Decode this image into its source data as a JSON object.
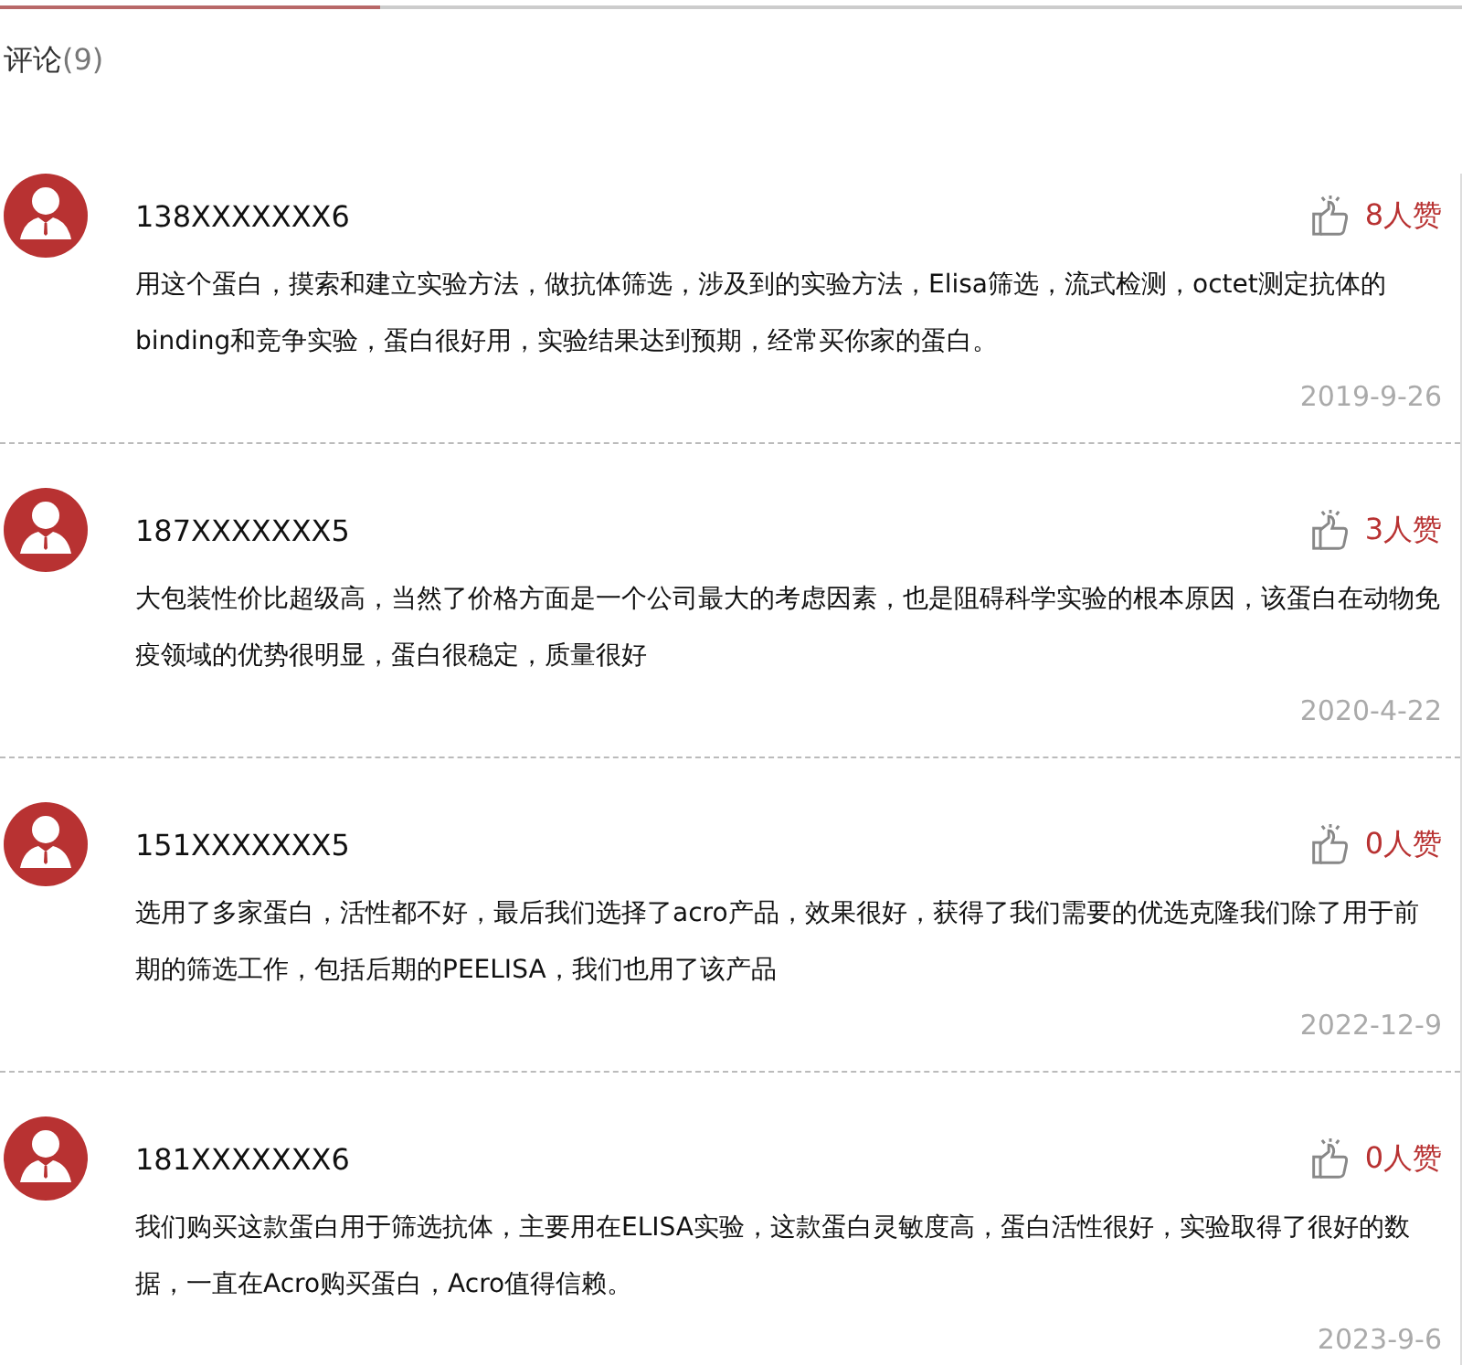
{
  "heading": {
    "label": "评论",
    "count": "(9)"
  },
  "comments": [
    {
      "user": "138XXXXXXX6",
      "likes": "8人赞",
      "text": "用这个蛋白，摸索和建立实验方法，做抗体筛选，涉及到的实验方法，Elisa筛选，流式检测，octet测定抗体的binding和竞争实验，蛋白很好用，实验结果达到预期，经常买你家的蛋白。",
      "date": "2019-9-26"
    },
    {
      "user": "187XXXXXXX5",
      "likes": "3人赞",
      "text": "大包装性价比超级高，当然了价格方面是一个公司最大的考虑因素，也是阻碍科学实验的根本原因，该蛋白在动物免疫领域的优势很明显，蛋白很稳定，质量很好",
      "date": "2020-4-22"
    },
    {
      "user": "151XXXXXXX5",
      "likes": "0人赞",
      "text": "选用了多家蛋白，活性都不好，最后我们选择了acro产品，效果很好，获得了我们需要的优选克隆我们除了用于前期的筛选工作，包括后期的PEELISA，我们也用了该产品",
      "date": "2022-12-9"
    },
    {
      "user": "181XXXXXXX6",
      "likes": "0人赞",
      "text": "我们购买这款蛋白用于筛选抗体，主要用在ELISA实验，这款蛋白灵敏度高，蛋白活性很好，实验取得了很好的数据，一直在Acro购买蛋白，Acro值得信赖。",
      "date": "2023-9-6"
    }
  ]
}
